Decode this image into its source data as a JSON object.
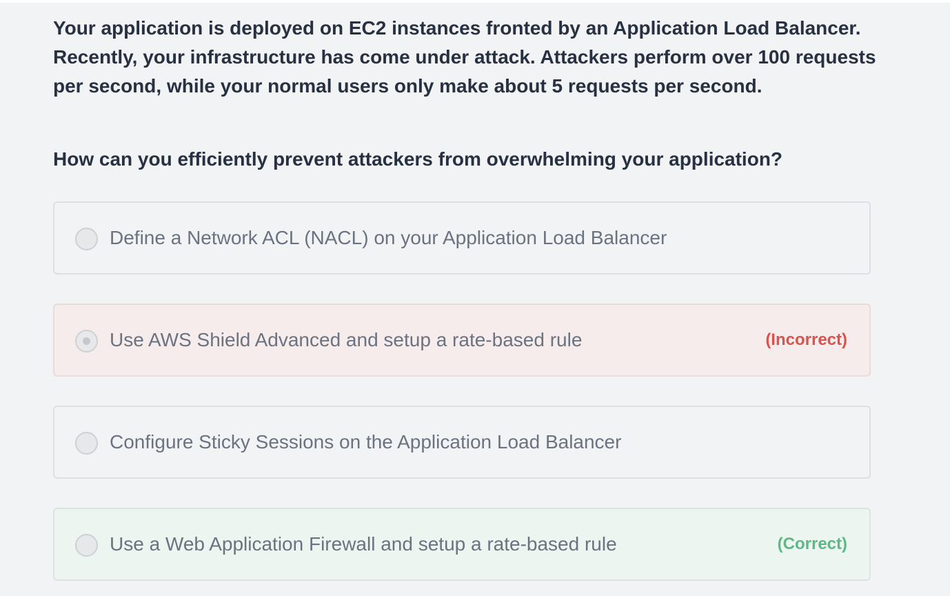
{
  "question": {
    "text": "Your application is deployed on EC2 instances fronted by an Application Load Balancer. Recently, your infrastructure has come under attack. Attackers perform over 100 requests per second, while your normal users only make about 5 requests per second.",
    "prompt": "How can you efficiently prevent attackers from overwhelming your application?"
  },
  "options": [
    {
      "label": "Define a Network ACL (NACL) on your Application Load Balancer",
      "verdict": "",
      "selected": false
    },
    {
      "label": "Use AWS Shield Advanced and setup a rate-based rule",
      "verdict": "(Incorrect)",
      "selected": true
    },
    {
      "label": "Configure Sticky Sessions on the Application Load Balancer",
      "verdict": "",
      "selected": false
    },
    {
      "label": "Use a Web Application Firewall and setup a rate-based rule",
      "verdict": "(Correct)",
      "selected": false
    }
  ],
  "colors": {
    "incorrect_text": "#d9534f",
    "correct_text": "#5cb887",
    "incorrect_bg": "#f6eceb",
    "correct_bg": "#edf5f0",
    "page_bg": "#f2f3f5"
  },
  "icons": {
    "radio": "radio-button-icon"
  }
}
